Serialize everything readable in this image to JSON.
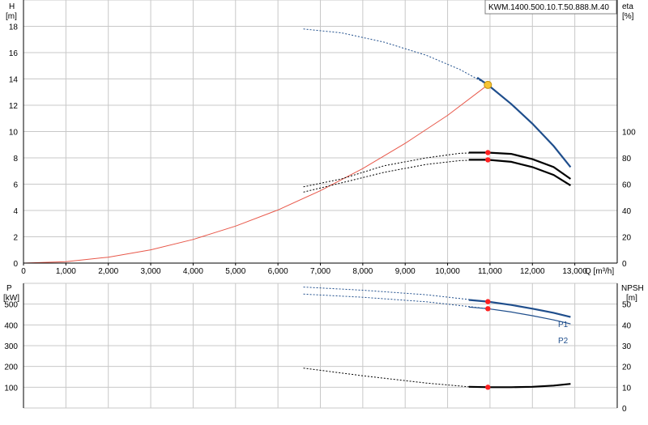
{
  "model_label": "KWM.1400.500.10.T.50.888.M.40",
  "colors": {
    "grid": "#c8c8c8",
    "axis": "#000000",
    "head_curve": "#1f4e8c",
    "system_curve": "#e8584a",
    "efficiency_curve": "#000000",
    "power_curve": "#1f4e8c",
    "npsh_curve": "#000000",
    "marker": "#ff2020",
    "op_point_fill": "#f7c435",
    "op_point_stroke": "#c09010"
  },
  "chart_data": [
    {
      "type": "line",
      "x_tick_unit": "Q [m³/h]",
      "xlim": [
        0,
        14000
      ],
      "x_ticks": [
        "0",
        "1,000",
        "2,000",
        "3,000",
        "4,000",
        "5,000",
        "6,000",
        "7,000",
        "8,000",
        "9,000",
        "10,000",
        "11,000",
        "12,000",
        "13,000"
      ],
      "x_tick_values": [
        0,
        1000,
        2000,
        3000,
        4000,
        5000,
        6000,
        7000,
        8000,
        9000,
        10000,
        11000,
        12000,
        13000
      ],
      "left_axis": {
        "label": "H",
        "unit": "[m]",
        "ylim": [
          0,
          20
        ],
        "ticks": [
          0,
          2,
          4,
          6,
          8,
          10,
          12,
          14,
          16,
          18
        ]
      },
      "right_axis": {
        "label": "eta",
        "unit": "[%]",
        "ylim": [
          0,
          100
        ],
        "tick_values": [
          0,
          20,
          40,
          60,
          80,
          100
        ],
        "ticks_at_left_scale": [
          0,
          2,
          4,
          6,
          8,
          10
        ]
      },
      "grid": true,
      "series": [
        {
          "role": "head",
          "axis": "left",
          "dashed_x": [
            6600,
            7500,
            8500,
            9500,
            10300,
            10950
          ],
          "dashed_y": [
            17.8,
            17.5,
            16.8,
            15.8,
            14.7,
            13.55
          ],
          "solid_x": [
            10700,
            10950,
            11500,
            12000,
            12500,
            12900
          ],
          "solid_y": [
            14.1,
            13.55,
            12.1,
            10.6,
            8.9,
            7.3
          ]
        },
        {
          "role": "system",
          "axis": "left",
          "x": [
            0,
            1000,
            2000,
            3000,
            4000,
            5000,
            6000,
            7000,
            8000,
            9000,
            10000,
            10950
          ],
          "y": [
            0,
            0.11,
            0.45,
            1.01,
            1.8,
            2.81,
            4.04,
            5.5,
            7.19,
            9.1,
            11.23,
            13.55
          ]
        },
        {
          "role": "efficiency_upper",
          "axis": "right",
          "dashed_x": [
            6600,
            7500,
            8500,
            9500,
            10300,
            10950
          ],
          "dashed_y": [
            58,
            64,
            74,
            80,
            83.5,
            84
          ],
          "solid_x": [
            10500,
            10950,
            11500,
            12000,
            12500,
            12900
          ],
          "solid_y": [
            84,
            84,
            83,
            79,
            73,
            64
          ],
          "marker": [
            10950,
            84
          ]
        },
        {
          "role": "efficiency_lower",
          "axis": "right",
          "dashed_x": [
            6600,
            7500,
            8500,
            9500,
            10300,
            10950
          ],
          "dashed_y": [
            54,
            61,
            69,
            75,
            78,
            78.5
          ],
          "solid_x": [
            10500,
            10950,
            11500,
            12000,
            12500,
            12900
          ],
          "solid_y": [
            78.5,
            78.5,
            77,
            73,
            67,
            59
          ],
          "marker": [
            10950,
            78.5
          ]
        }
      ],
      "operating_point": {
        "x": 10950,
        "y": 13.55
      }
    },
    {
      "type": "line",
      "x_ticks": [],
      "xlim": [
        0,
        14000
      ],
      "left_axis": {
        "label": "P",
        "unit": "[kW]",
        "ylim": [
          0,
          600
        ],
        "ticks": [
          100,
          200,
          300,
          400,
          500
        ]
      },
      "right_axis": {
        "label": "NPSH",
        "unit": "[m]",
        "ylim": [
          0,
          60
        ],
        "ticks": [
          0,
          10,
          20,
          30,
          40,
          50
        ]
      },
      "grid": true,
      "series": [
        {
          "name": "P1",
          "axis": "left",
          "dashed_x": [
            6600,
            8000,
            9500,
            10950
          ],
          "dashed_y": [
            582,
            567,
            545,
            512
          ],
          "solid_x": [
            10500,
            10950,
            11500,
            12000,
            12500,
            12900
          ],
          "solid_y": [
            520,
            512,
            496,
            478,
            458,
            438
          ],
          "marker": [
            10950,
            512
          ]
        },
        {
          "name": "P2",
          "axis": "left",
          "dashed_x": [
            6600,
            8000,
            9500,
            10950
          ],
          "dashed_y": [
            548,
            533,
            511,
            478
          ],
          "solid_x": [
            10500,
            10950,
            11500,
            12000,
            12500,
            12900
          ],
          "solid_y": [
            486,
            478,
            462,
            444,
            424,
            405
          ],
          "marker": [
            10950,
            478
          ]
        },
        {
          "role": "npsh",
          "axis": "right",
          "dashed_x": [
            6600,
            8000,
            9500,
            10500
          ],
          "dashed_y": [
            19.2,
            15.5,
            12,
            10.2
          ],
          "solid_x": [
            10500,
            11000,
            11500,
            12000,
            12500,
            12900
          ],
          "solid_y": [
            10.2,
            10,
            10,
            10.2,
            10.8,
            11.6
          ],
          "marker": [
            10950,
            10
          ]
        }
      ]
    }
  ]
}
